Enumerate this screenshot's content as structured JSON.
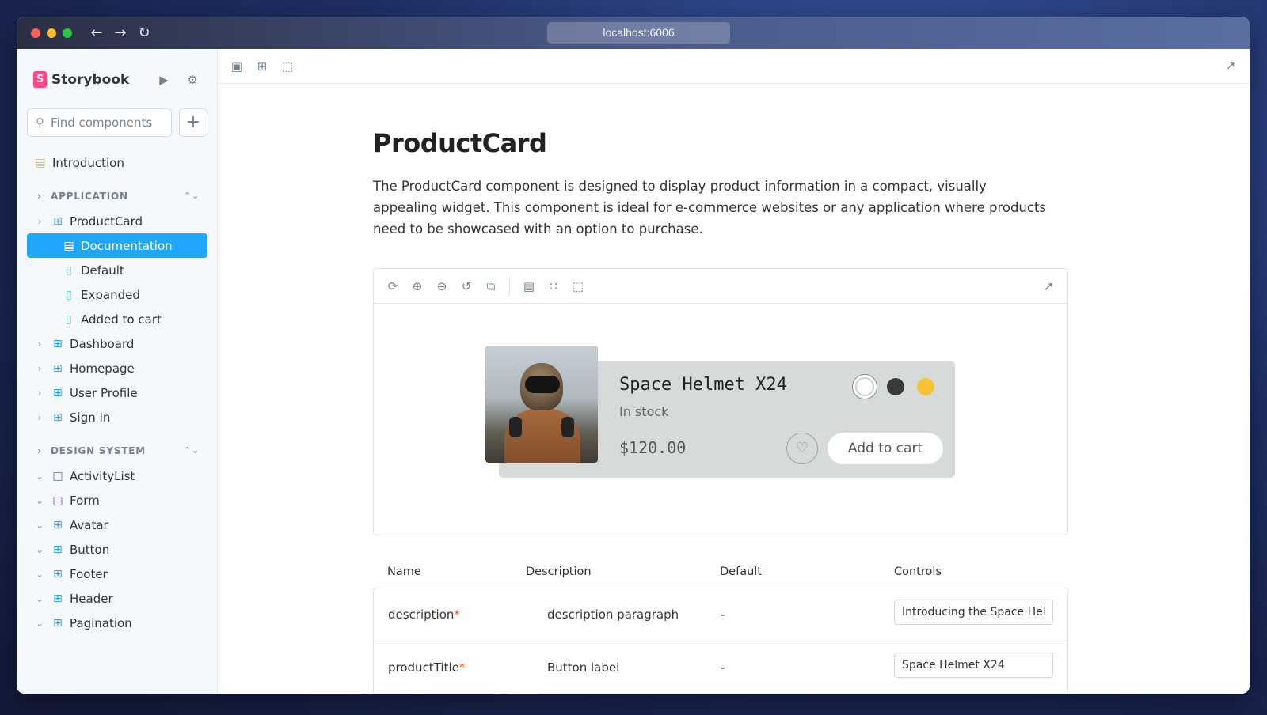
{
  "browser": {
    "url": "localhost:6006"
  },
  "sidebar": {
    "brand": "Storybook",
    "search_placeholder": "Find components",
    "introduction": "Introduction",
    "groups": [
      {
        "label": "APPLICATION",
        "items": [
          {
            "label": "ProductCard",
            "children": [
              "Documentation",
              "Default",
              "Expanded",
              "Added to cart"
            ]
          },
          {
            "label": "Dashboard"
          },
          {
            "label": "Homepage"
          },
          {
            "label": "User Profile"
          },
          {
            "label": "Sign In"
          }
        ]
      },
      {
        "label": "DESIGN SYSTEM",
        "items": [
          {
            "label": "ActivityList"
          },
          {
            "label": "Form"
          },
          {
            "label": "Avatar"
          },
          {
            "label": "Button"
          },
          {
            "label": "Footer"
          },
          {
            "label": "Header"
          },
          {
            "label": "Pagination"
          }
        ]
      }
    ]
  },
  "doc": {
    "title": "ProductCard",
    "description": "The ProductCard component is designed to display product information in a compact, visually appealing widget. This component is ideal for e-commerce websites or any application where products need to be showcased with an option to purchase."
  },
  "product": {
    "title": "Space Helmet X24",
    "stock": "In stock",
    "price": "$120.00",
    "cart_label": "Add to cart",
    "swatch_colors": [
      "#ffffff",
      "#3a3a3a",
      "#f4c232"
    ]
  },
  "args_table": {
    "headers": [
      "Name",
      "Description",
      "Default",
      "Controls"
    ],
    "rows": [
      {
        "name": "description",
        "required_mark": "*",
        "description": "description paragraph",
        "default": "-",
        "control_value": "Introducing the Space Hel..."
      },
      {
        "name": "productTitle",
        "required_mark": "*",
        "description": "Button label",
        "default": "-",
        "control_value": "Space Helmet X24"
      }
    ]
  },
  "colors": {
    "accent": "#1ea7fd",
    "brand": "#ff4785"
  }
}
